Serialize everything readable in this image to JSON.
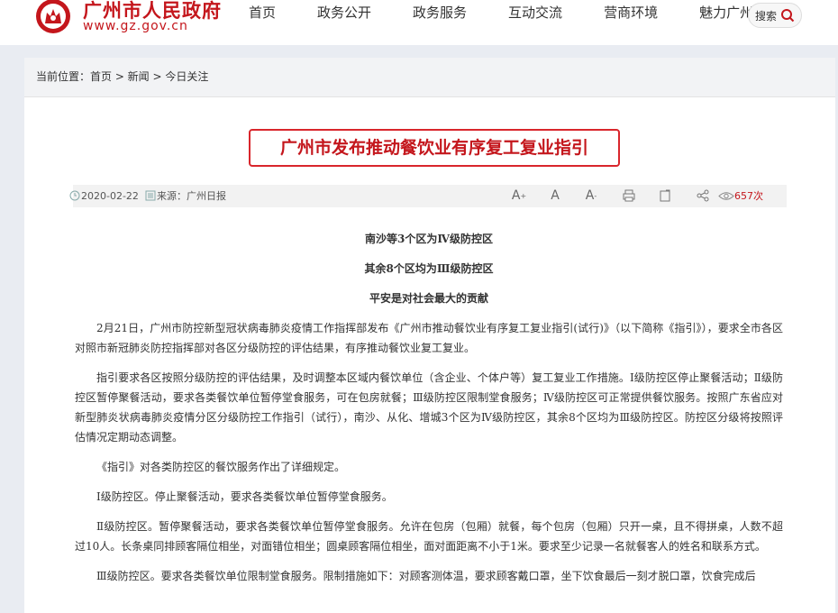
{
  "header": {
    "site_name": "广州市人民政府",
    "site_url": "www.gz.gov.cn",
    "nav": [
      "首页",
      "政务公开",
      "政务服务",
      "互动交流",
      "营商环境",
      "魅力广州"
    ],
    "search_label": "搜索"
  },
  "breadcrumb": "当前位置：首页 > 新闻 > 今日关注",
  "article": {
    "title": "广州市发布推动餐饮业有序复工复业指引",
    "date": "2020-02-22",
    "source": "来源：广州日报",
    "views": "657次",
    "subtitles": [
      "南沙等3个区为Ⅳ级防控区",
      "其余8个区均为Ⅲ级防控区",
      "平安是对社会最大的贡献"
    ],
    "paragraphs": [
      "2月21日，广州市防控新型冠状病毒肺炎疫情工作指挥部发布《广州市推动餐饮业有序复工复业指引(试行)》（以下简称《指引》），要求全市各区对照市新冠肺炎防控指挥部对各区分级防控的评估结果，有序推动餐饮业复工复业。",
      "指引要求各区按照分级防控的评估结果，及时调整本区域内餐饮单位（含企业、个体户等）复工复业工作措施。Ⅰ级防控区停止聚餐活动；Ⅱ级防控区暂停聚餐活动，要求各类餐饮单位暂停堂食服务，可在包房就餐；Ⅲ级防控区限制堂食服务；Ⅳ级防控区可正常提供餐饮服务。按照广东省应对新型肺炎状病毒肺炎疫情分区分级防控工作指引（试行），南沙、从化、增城3个区为Ⅳ级防控区，其余8个区均为Ⅲ级防控区。防控区分级将按照评估情况定期动态调整。",
      "《指引》对各类防控区的餐饮服务作出了详细规定。",
      "Ⅰ级防控区。停止聚餐活动，要求各类餐饮单位暂停堂食服务。",
      "Ⅱ级防控区。暂停聚餐活动，要求各类餐饮单位暂停堂食服务。允许在包房（包厢）就餐，每个包房（包厢）只开一桌，且不得拼桌，人数不超过10人。长条桌同排顾客隔位相坐，对面错位相坐；圆桌顾客隔位相坐，面对面距离不小于1米。要求至少记录一名就餐客人的姓名和联系方式。",
      "Ⅲ级防控区。要求各类餐饮单位限制堂食服务。限制措施如下：对顾客测体温，要求顾客戴口罩，坐下饮食最后一刻才脱口罩，饮食完成后"
    ]
  },
  "colors": {
    "brand_red": "#c4161c",
    "title_border": "#d9262c"
  },
  "icons": [
    "emblem-icon",
    "search-icon",
    "clock-icon",
    "source-icon",
    "font-increase-icon",
    "font-reset-icon",
    "font-decrease-icon",
    "print-icon",
    "bookmark-icon",
    "share-icon",
    "eye-icon"
  ]
}
